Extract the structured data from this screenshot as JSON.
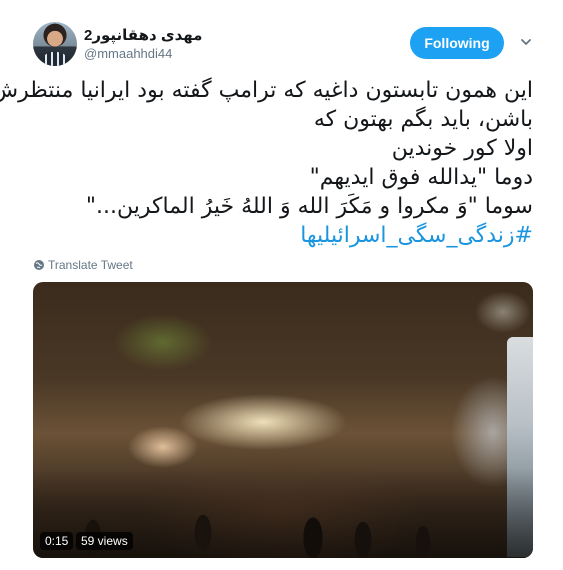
{
  "author": {
    "name": "مهدی دهقانپور2",
    "handle": "@mmaahhdi44"
  },
  "follow_button": {
    "label": "Following"
  },
  "tweet": {
    "lines": [
      "این همون تابستون داغیه که ترامپ گفته بود ایرانیا منتظرش",
      "باشن، باید بگم بهتون که",
      "اولا کور خوندین",
      "دوما \"یدالله فوق ایدیهم\"",
      "سوما \"وَ مکروا و مَکَرَ الله وَ اللهُ خَیرُ الماکرین...\""
    ],
    "hashtag": "#زندگی_سگی_اسرائیلیها"
  },
  "translate": {
    "label": "Translate Tweet"
  },
  "video": {
    "duration": "0:15",
    "views": "59 views"
  },
  "colors": {
    "accent": "#1da1f2",
    "hashtag": "#1b95e0",
    "muted": "#657786"
  },
  "icons": {
    "menu": "chevron-down-icon",
    "translate": "globe-icon"
  }
}
